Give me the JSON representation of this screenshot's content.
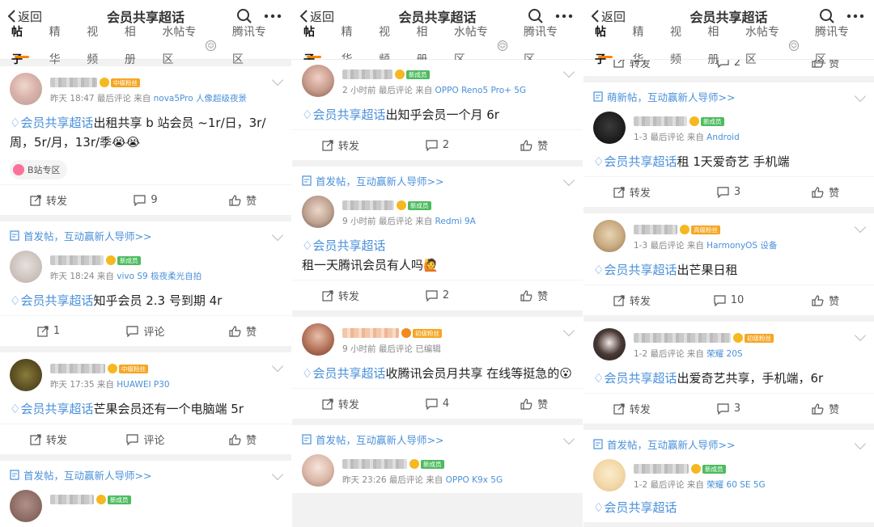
{
  "header": {
    "back_label": "返回",
    "title": "会员共享超话"
  },
  "tabs": [
    "帖子",
    "精华",
    "视频",
    "相册",
    "水帖专区",
    "腾讯专区"
  ],
  "hint_text": "首发帖，互动赢新人导师>>",
  "hint_text_cute": "萌新帖，互动赢新人导师>>",
  "topic": "会员共享超话",
  "action_labels": {
    "forward": "转发",
    "comment": "评论",
    "like": "赞"
  },
  "colors": {
    "accent": "#ff8200",
    "link": "#4a90d9",
    "bg": "#f2f2f2"
  },
  "panels": [
    {
      "posts": [
        {
          "meta": "昨天 18:47 最后评论  来自",
          "source": "nova5Pro 人像超级夜景",
          "badge": "中级粉丝",
          "badge_color": "orange",
          "text": "出租共享 b 站会员 ~1r/日，3r/周，5r/月，13r/季😭😭",
          "tag": "B站专区",
          "forward": "转发",
          "comment": "9",
          "like": "赞"
        },
        {
          "hint": true,
          "meta": "昨天 18:24  来自",
          "source": "vivo S9 极夜柔光自拍",
          "badge": "新成员",
          "badge_color": "green",
          "text": "知乎会员 2.3 号到期 4r",
          "forward": "1",
          "comment": "评论",
          "like": "赞"
        },
        {
          "meta": "昨天 17:35  来自",
          "source": "HUAWEI P30",
          "badge": "中级粉丝",
          "badge_color": "orange",
          "text": "芒果会员还有一个电脑端 5r",
          "forward": "转发",
          "comment": "评论",
          "like": "赞"
        },
        {
          "hint": true,
          "meta": "",
          "source": "",
          "badge": "新成员",
          "badge_color": "green",
          "text": "",
          "partial": true
        }
      ]
    },
    {
      "posts": [
        {
          "meta": "2 小时前 最后评论  来自",
          "source": "OPPO Reno5 Pro+ 5G",
          "badge": "新成员",
          "badge_color": "green",
          "text": "出知乎会员一个月 6r",
          "forward": "转发",
          "comment": "2",
          "like": "赞"
        },
        {
          "hint": true,
          "meta": "9 小时前 最后评论  来自",
          "source": "Redmi 9A",
          "badge": "新成员",
          "badge_color": "green",
          "text": "\n租一天腾讯会员有人吗🙋",
          "forward": "转发",
          "comment": "2",
          "like": "赞"
        },
        {
          "meta": "9 小时前 最后评论   已编辑",
          "source": "",
          "badge": "初级粉丝",
          "badge_color": "orange",
          "text": "收腾讯会员月共享 在线等挺急的😮",
          "forward": "转发",
          "comment": "4",
          "like": "赞"
        },
        {
          "hint": true,
          "meta": "昨天 23:26 最后评论  来自",
          "source": "OPPO K9x 5G",
          "badge": "新成员",
          "badge_color": "green",
          "text": "",
          "partial": true
        }
      ]
    },
    {
      "posts": [
        {
          "topstub": true,
          "forward": "转发",
          "comment": "2",
          "like": "赞"
        },
        {
          "hint_cute": true,
          "meta": "1-3 最后评论  来自",
          "source": "Android",
          "badge": "新成员",
          "badge_color": "green",
          "text": "租 1天爱奇艺 手机端",
          "forward": "转发",
          "comment": "3",
          "like": "赞"
        },
        {
          "meta": "1-3 最后评论  来自",
          "source": "HarmonyOS 设备",
          "badge": "高级粉丝",
          "badge_color": "orange",
          "text": "出芒果日租",
          "forward": "转发",
          "comment": "10",
          "like": "赞"
        },
        {
          "meta": "1-2 最后评论  来自",
          "source": "荣耀 20S",
          "badge": "初级粉丝",
          "badge_color": "orange",
          "text": "出爱奇艺共享，手机端，6r",
          "forward": "转发",
          "comment": "3",
          "like": "赞"
        },
        {
          "hint": true,
          "meta": "1-2 最后评论  来自",
          "source": "荣耀 60 SE 5G",
          "badge": "新成员",
          "badge_color": "green",
          "text": "",
          "partial": true
        }
      ]
    }
  ]
}
